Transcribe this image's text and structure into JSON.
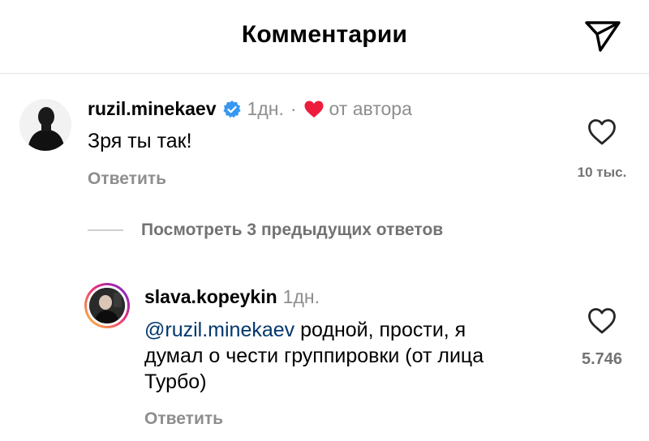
{
  "header": {
    "title": "Комментарии",
    "send_icon": "paper-plane-icon"
  },
  "comments": [
    {
      "username": "ruzil.minekaev",
      "verified": true,
      "time": "1дн.",
      "separator": "·",
      "author_liked_label": "от автора",
      "text": "Зря ты так!",
      "reply_label": "Ответить",
      "likes": "10 тыс."
    }
  ],
  "view_previous": {
    "label": "Посмотреть 3 предыдущих ответов"
  },
  "replies": [
    {
      "username": "slava.kopeykin",
      "time": "1дн.",
      "mention": "@ruzil.minekaev",
      "text_lines": [
        "родной, прости, я",
        "думал о чести группировки (от лица",
        "Турбо)"
      ],
      "reply_label": "Ответить",
      "likes": "5.746"
    }
  ],
  "colors": {
    "verified": "#3897f0",
    "heart_red": "#ed1c3d",
    "mention": "#00376b",
    "muted": "#8e8e8e"
  }
}
